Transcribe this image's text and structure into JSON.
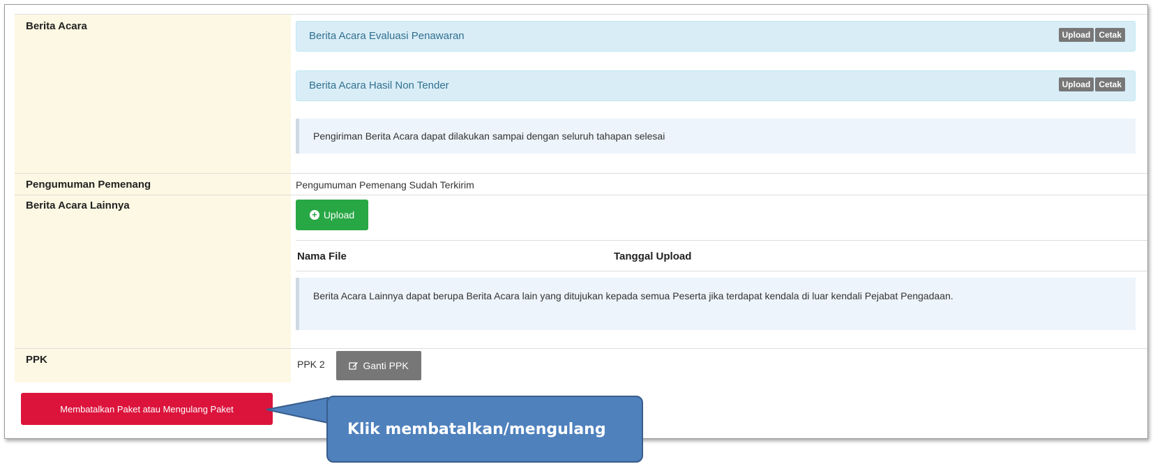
{
  "berita_acara": {
    "label": "Berita Acara",
    "panels": [
      {
        "title": "Berita Acara Evaluasi Penawaran",
        "upload_label": "Upload",
        "print_label": "Cetak"
      },
      {
        "title": "Berita Acara Hasil Non Tender",
        "upload_label": "Upload",
        "print_label": "Cetak"
      }
    ],
    "note": "Pengiriman Berita Acara dapat dilakukan sampai dengan seluruh tahapan selesai"
  },
  "pengumuman": {
    "label": "Pengumuman Pemenang",
    "value": "Pengumuman Pemenang Sudah Terkirim"
  },
  "berita_lain": {
    "label": "Berita Acara Lainnya",
    "upload_label": "Upload",
    "table_headers": [
      "Nama File",
      "Tanggal Upload"
    ],
    "note": "Berita Acara Lainnya dapat berupa Berita Acara lain yang ditujukan kepada semua Peserta jika terdapat kendala di luar kendali Pejabat Pengadaan."
  },
  "ppk": {
    "label": "PPK",
    "value": "PPK 2",
    "change_label": "Ganti PPK"
  },
  "cancel_button_label": "Membatalkan Paket atau Mengulang Paket",
  "callout_text": "Klik membatalkan/mengulang",
  "colors": {
    "label_bg": "#fcf8e3",
    "panel_bg": "#d9edf7",
    "panel_text": "#31708f",
    "success": "#28a745",
    "danger": "#dc143c",
    "callout": "#4f81bd"
  },
  "icons": [
    "plus-circle-icon",
    "edit-icon"
  ]
}
